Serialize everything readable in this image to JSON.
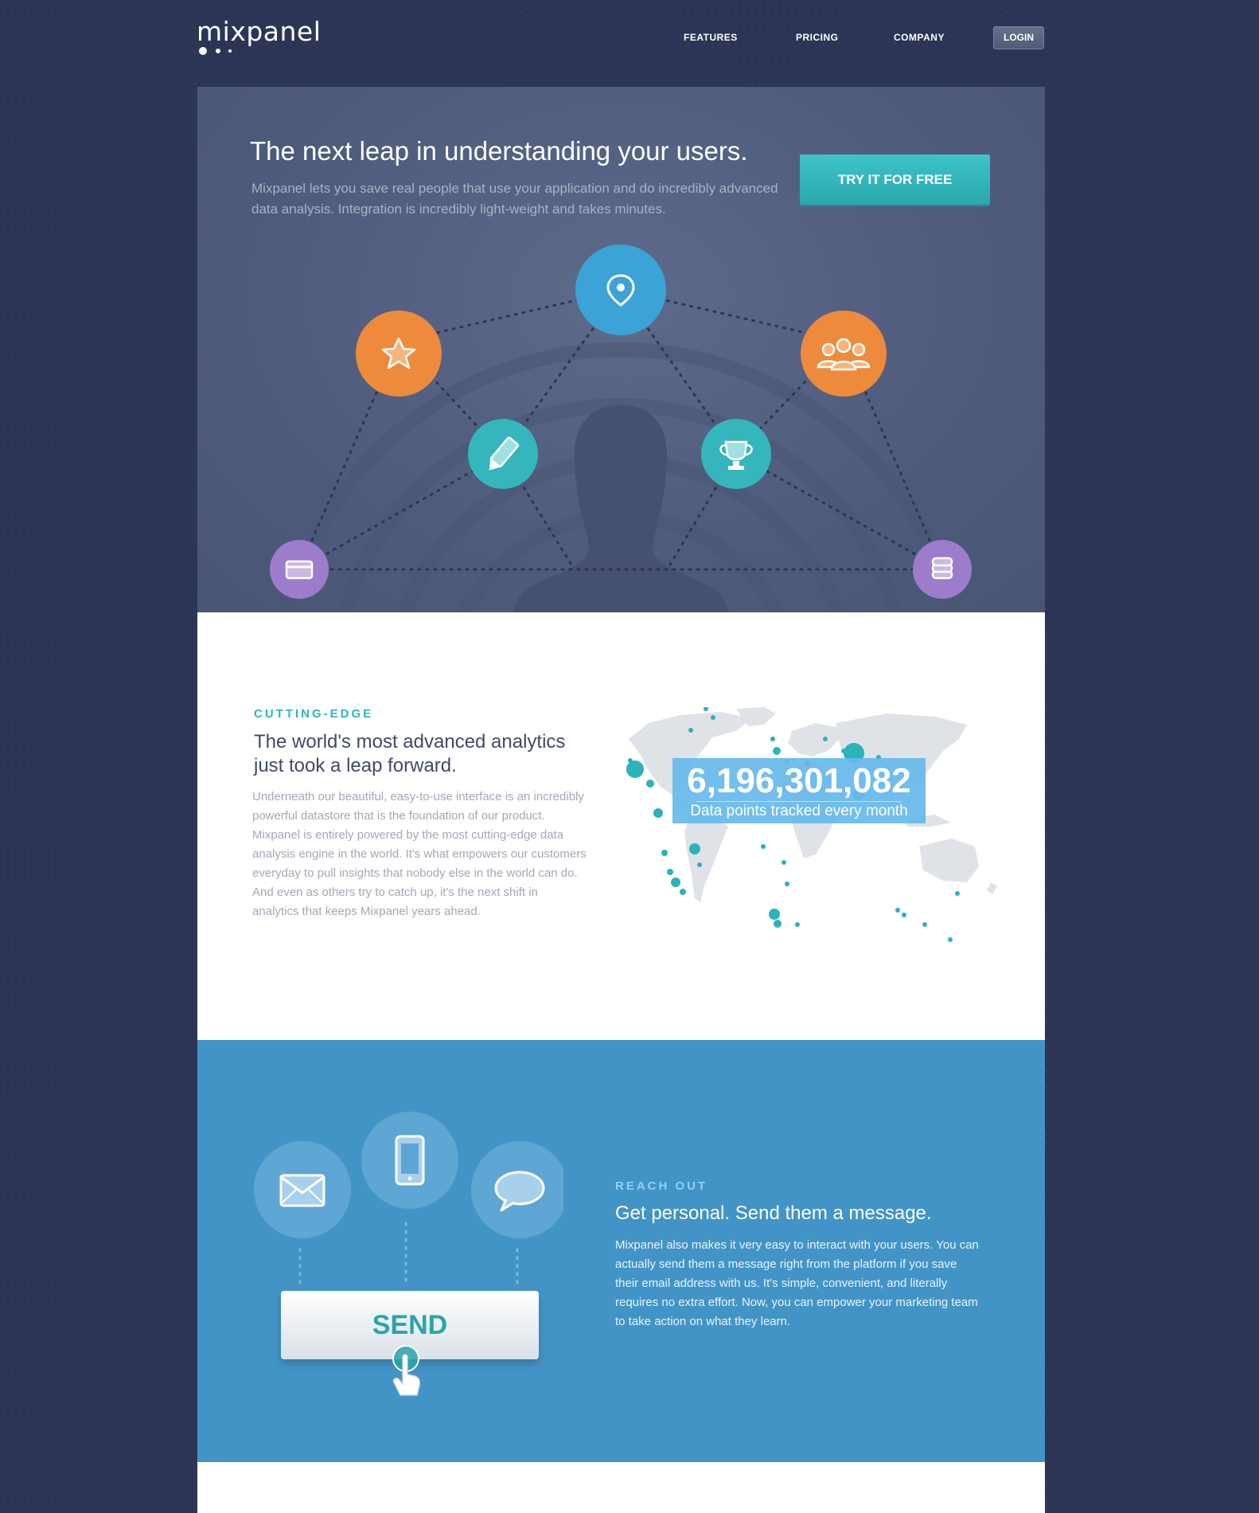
{
  "header": {
    "logo_text": "mixpanel",
    "nav": [
      "FEATURES",
      "PRICING",
      "COMPANY"
    ],
    "login_label": "LOGIN"
  },
  "hero": {
    "title": "The next leap in understanding your users.",
    "description": "Mixpanel lets you save real people that use your application and do incredibly advanced data analysis. Integration is incredibly light-weight and takes minutes.",
    "cta_label": "TRY IT FOR FREE",
    "icons": [
      "location-pin-icon",
      "star-icon",
      "group-icon",
      "pencil-icon",
      "trophy-icon",
      "credit-card-icon",
      "coins-icon"
    ]
  },
  "analytics": {
    "eyebrow": "CUTTING-EDGE",
    "title": "The world's most advanced analytics just took a leap forward.",
    "body": "Underneath our beautiful, easy-to-use interface is an incredibly powerful datastore that is the foundation of our product. Mixpanel is entirely powered by the most cutting-edge data analysis engine in the world. It's what empowers our customers everyday to pull insights that nobody else in the world can do. And even as others try to catch up, it's the next shift in analytics that keeps Mixpanel years ahead.",
    "stat_value": "6,196,301,082",
    "stat_label": "Data points tracked every month"
  },
  "reach": {
    "eyebrow": "REACH OUT",
    "title": "Get personal. Send them a message.",
    "body": "Mixpanel also makes it very easy to interact with your users. You can actually send them a message right from the platform if you save their email address with us. It's simple, convenient, and literally requires no extra effort. Now, you can empower your marketing team to take action on what they learn.",
    "send_label": "SEND",
    "icons": [
      "envelope-icon",
      "smartphone-icon",
      "chat-bubble-icon"
    ]
  },
  "colors": {
    "page_bg": "#2c3556",
    "hero_bg": "#556181",
    "teal": "#35b6bc",
    "orange": "#ee8a3c",
    "blue_icon": "#3ba3d6",
    "purple": "#9d7ccb",
    "section_blue": "#4394c6"
  }
}
